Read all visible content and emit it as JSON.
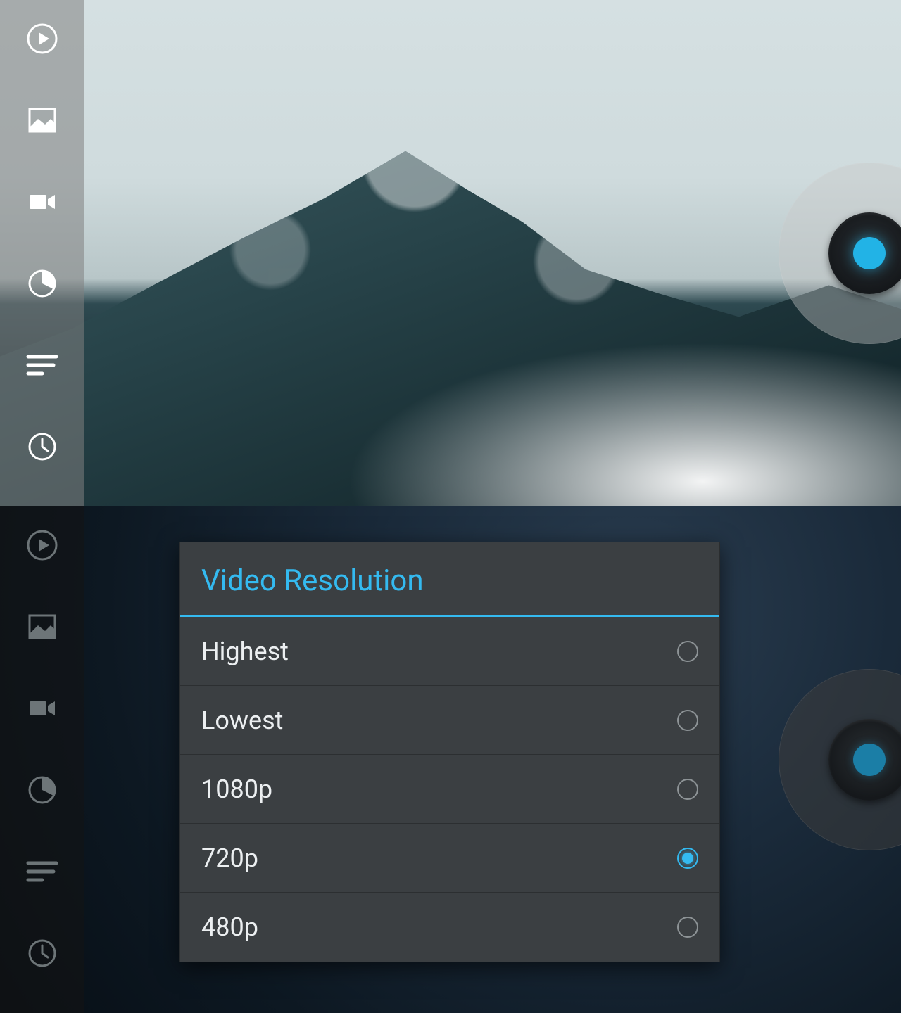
{
  "colors": {
    "accent": "#34baf0"
  },
  "sidebar": {
    "items": [
      {
        "name": "play-icon"
      },
      {
        "name": "image-icon"
      },
      {
        "name": "video-icon"
      },
      {
        "name": "pie-timer-icon"
      },
      {
        "name": "burst-lines-icon"
      },
      {
        "name": "clock-icon"
      }
    ]
  },
  "shutter": {
    "name": "record-button"
  },
  "dialog": {
    "title": "Video Resolution",
    "options": [
      {
        "label": "Highest",
        "selected": false
      },
      {
        "label": "Lowest",
        "selected": false
      },
      {
        "label": "1080p",
        "selected": false
      },
      {
        "label": "720p",
        "selected": true
      },
      {
        "label": "480p",
        "selected": false
      }
    ]
  }
}
